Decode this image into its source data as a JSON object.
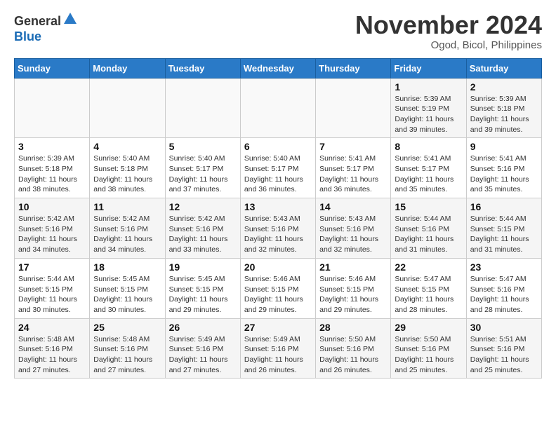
{
  "logo": {
    "general": "General",
    "blue": "Blue"
  },
  "header": {
    "title": "November 2024",
    "subtitle": "Ogod, Bicol, Philippines"
  },
  "weekdays": [
    "Sunday",
    "Monday",
    "Tuesday",
    "Wednesday",
    "Thursday",
    "Friday",
    "Saturday"
  ],
  "weeks": [
    [
      {
        "day": "",
        "info": ""
      },
      {
        "day": "",
        "info": ""
      },
      {
        "day": "",
        "info": ""
      },
      {
        "day": "",
        "info": ""
      },
      {
        "day": "",
        "info": ""
      },
      {
        "day": "1",
        "sunrise": "Sunrise: 5:39 AM",
        "sunset": "Sunset: 5:19 PM",
        "daylight": "Daylight: 11 hours and 39 minutes."
      },
      {
        "day": "2",
        "sunrise": "Sunrise: 5:39 AM",
        "sunset": "Sunset: 5:18 PM",
        "daylight": "Daylight: 11 hours and 39 minutes."
      }
    ],
    [
      {
        "day": "3",
        "sunrise": "Sunrise: 5:39 AM",
        "sunset": "Sunset: 5:18 PM",
        "daylight": "Daylight: 11 hours and 38 minutes."
      },
      {
        "day": "4",
        "sunrise": "Sunrise: 5:40 AM",
        "sunset": "Sunset: 5:18 PM",
        "daylight": "Daylight: 11 hours and 38 minutes."
      },
      {
        "day": "5",
        "sunrise": "Sunrise: 5:40 AM",
        "sunset": "Sunset: 5:17 PM",
        "daylight": "Daylight: 11 hours and 37 minutes."
      },
      {
        "day": "6",
        "sunrise": "Sunrise: 5:40 AM",
        "sunset": "Sunset: 5:17 PM",
        "daylight": "Daylight: 11 hours and 36 minutes."
      },
      {
        "day": "7",
        "sunrise": "Sunrise: 5:41 AM",
        "sunset": "Sunset: 5:17 PM",
        "daylight": "Daylight: 11 hours and 36 minutes."
      },
      {
        "day": "8",
        "sunrise": "Sunrise: 5:41 AM",
        "sunset": "Sunset: 5:17 PM",
        "daylight": "Daylight: 11 hours and 35 minutes."
      },
      {
        "day": "9",
        "sunrise": "Sunrise: 5:41 AM",
        "sunset": "Sunset: 5:16 PM",
        "daylight": "Daylight: 11 hours and 35 minutes."
      }
    ],
    [
      {
        "day": "10",
        "sunrise": "Sunrise: 5:42 AM",
        "sunset": "Sunset: 5:16 PM",
        "daylight": "Daylight: 11 hours and 34 minutes."
      },
      {
        "day": "11",
        "sunrise": "Sunrise: 5:42 AM",
        "sunset": "Sunset: 5:16 PM",
        "daylight": "Daylight: 11 hours and 34 minutes."
      },
      {
        "day": "12",
        "sunrise": "Sunrise: 5:42 AM",
        "sunset": "Sunset: 5:16 PM",
        "daylight": "Daylight: 11 hours and 33 minutes."
      },
      {
        "day": "13",
        "sunrise": "Sunrise: 5:43 AM",
        "sunset": "Sunset: 5:16 PM",
        "daylight": "Daylight: 11 hours and 32 minutes."
      },
      {
        "day": "14",
        "sunrise": "Sunrise: 5:43 AM",
        "sunset": "Sunset: 5:16 PM",
        "daylight": "Daylight: 11 hours and 32 minutes."
      },
      {
        "day": "15",
        "sunrise": "Sunrise: 5:44 AM",
        "sunset": "Sunset: 5:16 PM",
        "daylight": "Daylight: 11 hours and 31 minutes."
      },
      {
        "day": "16",
        "sunrise": "Sunrise: 5:44 AM",
        "sunset": "Sunset: 5:15 PM",
        "daylight": "Daylight: 11 hours and 31 minutes."
      }
    ],
    [
      {
        "day": "17",
        "sunrise": "Sunrise: 5:44 AM",
        "sunset": "Sunset: 5:15 PM",
        "daylight": "Daylight: 11 hours and 30 minutes."
      },
      {
        "day": "18",
        "sunrise": "Sunrise: 5:45 AM",
        "sunset": "Sunset: 5:15 PM",
        "daylight": "Daylight: 11 hours and 30 minutes."
      },
      {
        "day": "19",
        "sunrise": "Sunrise: 5:45 AM",
        "sunset": "Sunset: 5:15 PM",
        "daylight": "Daylight: 11 hours and 29 minutes."
      },
      {
        "day": "20",
        "sunrise": "Sunrise: 5:46 AM",
        "sunset": "Sunset: 5:15 PM",
        "daylight": "Daylight: 11 hours and 29 minutes."
      },
      {
        "day": "21",
        "sunrise": "Sunrise: 5:46 AM",
        "sunset": "Sunset: 5:15 PM",
        "daylight": "Daylight: 11 hours and 29 minutes."
      },
      {
        "day": "22",
        "sunrise": "Sunrise: 5:47 AM",
        "sunset": "Sunset: 5:15 PM",
        "daylight": "Daylight: 11 hours and 28 minutes."
      },
      {
        "day": "23",
        "sunrise": "Sunrise: 5:47 AM",
        "sunset": "Sunset: 5:16 PM",
        "daylight": "Daylight: 11 hours and 28 minutes."
      }
    ],
    [
      {
        "day": "24",
        "sunrise": "Sunrise: 5:48 AM",
        "sunset": "Sunset: 5:16 PM",
        "daylight": "Daylight: 11 hours and 27 minutes."
      },
      {
        "day": "25",
        "sunrise": "Sunrise: 5:48 AM",
        "sunset": "Sunset: 5:16 PM",
        "daylight": "Daylight: 11 hours and 27 minutes."
      },
      {
        "day": "26",
        "sunrise": "Sunrise: 5:49 AM",
        "sunset": "Sunset: 5:16 PM",
        "daylight": "Daylight: 11 hours and 27 minutes."
      },
      {
        "day": "27",
        "sunrise": "Sunrise: 5:49 AM",
        "sunset": "Sunset: 5:16 PM",
        "daylight": "Daylight: 11 hours and 26 minutes."
      },
      {
        "day": "28",
        "sunrise": "Sunrise: 5:50 AM",
        "sunset": "Sunset: 5:16 PM",
        "daylight": "Daylight: 11 hours and 26 minutes."
      },
      {
        "day": "29",
        "sunrise": "Sunrise: 5:50 AM",
        "sunset": "Sunset: 5:16 PM",
        "daylight": "Daylight: 11 hours and 25 minutes."
      },
      {
        "day": "30",
        "sunrise": "Sunrise: 5:51 AM",
        "sunset": "Sunset: 5:16 PM",
        "daylight": "Daylight: 11 hours and 25 minutes."
      }
    ]
  ]
}
